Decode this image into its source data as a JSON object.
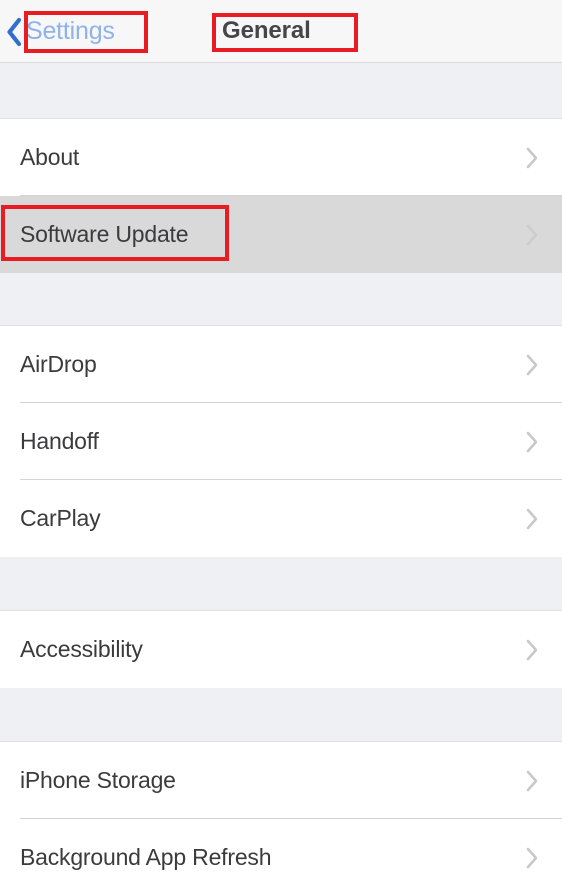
{
  "nav": {
    "back_label": "Settings",
    "back_icon": "chevron-left-icon",
    "title": "General"
  },
  "colors": {
    "accent_blue": "#8fb2e8",
    "annotation_red": "#e81c23",
    "row_background": "#ffffff",
    "row_highlighted": "#d9d9da",
    "group_background": "#eff0f3",
    "label_text": "#3b3b3d",
    "nav_background": "#f7f7f8",
    "chevron_gray": "#c9c9cb",
    "separator": "#d4d4d6"
  },
  "sections": [
    {
      "rows": [
        {
          "label": "About",
          "accessory": "chevron-right-icon",
          "highlighted": false
        },
        {
          "label": "Software Update",
          "accessory": "chevron-right-icon",
          "highlighted": true
        }
      ]
    },
    {
      "rows": [
        {
          "label": "AirDrop",
          "accessory": "chevron-right-icon",
          "highlighted": false
        },
        {
          "label": "Handoff",
          "accessory": "chevron-right-icon",
          "highlighted": false
        },
        {
          "label": "CarPlay",
          "accessory": "chevron-right-icon",
          "highlighted": false
        }
      ]
    },
    {
      "rows": [
        {
          "label": "Accessibility",
          "accessory": "chevron-right-icon",
          "highlighted": false
        }
      ]
    },
    {
      "rows": [
        {
          "label": "iPhone Storage",
          "accessory": "chevron-right-icon",
          "highlighted": false
        },
        {
          "label": "Background App Refresh",
          "accessory": "chevron-right-icon",
          "highlighted": false
        }
      ]
    }
  ],
  "annotations": [
    {
      "target": "back_label",
      "label": "Settings"
    },
    {
      "target": "nav_title",
      "label": "General"
    },
    {
      "target": "row_software_update",
      "label": "Software Update"
    }
  ]
}
